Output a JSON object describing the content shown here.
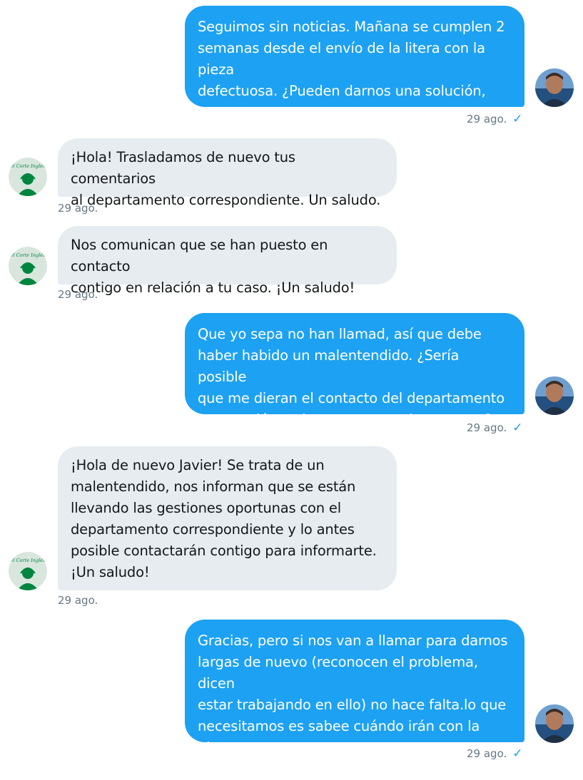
{
  "conversation": {
    "messages": [
      {
        "direction": "sent",
        "text": "Seguimos sin noticias. Mañana se cumplen 2\nsemanas desde el envío de la litera con la pieza\ndefectuosa. ¿Pueden darnos una solución, por\nfavor?",
        "time": "29 ago.",
        "read": true
      },
      {
        "direction": "received",
        "text": "¡Hola! Trasladamos de nuevo tus comentarios\nal departamento correspondiente. Un saludo.",
        "time": "29 ago."
      },
      {
        "direction": "received",
        "text": "Nos comunican que se han puesto en contacto\ncontigo en relación a tu caso. ¡Un saludo!",
        "time": "29 ago."
      },
      {
        "direction": "sent",
        "text": "Que yo sepa no han llamad, así que debe\nhaber habido un malentendido. ¿Sería posible\nque me dieran el contacto del departamento\nen cuestión y alguna persona de contacto?",
        "time": "29 ago.",
        "read": true
      },
      {
        "direction": "received",
        "text": "¡Hola de nuevo Javier! Se trata de un\nmalentendido, nos informan que se están\nllevando las gestiones oportunas con el\ndepartamento correspondiente y lo antes\nposible contactarán contigo para informarte.\n¡Un saludo!",
        "time": "29 ago."
      },
      {
        "direction": "sent",
        "text": "Gracias, pero si nos van a llamar para darnos\nlargas de nuevo (reconocen el problema, dicen\nestar trabajando en ello) no hace falta.lo que\nnecesitamos es sabee cuándo irán con la pieza\nque falta a montar la dichosa litera.",
        "time": "29 ago.",
        "read": true
      }
    ],
    "read_receipt_glyph": "✓",
    "received_avatar_logo_text": "el Corte Inglés",
    "colors": {
      "sent_bubble": "#1da1f2",
      "received_bubble": "#e6ecf0",
      "timestamp": "#657786",
      "brand_green": "#00853e"
    },
    "icons": {
      "sent_avatar": "user-photo-avatar",
      "received_avatar": "el-corte-ingles-support-avatar",
      "read_receipt": "check-icon"
    }
  }
}
